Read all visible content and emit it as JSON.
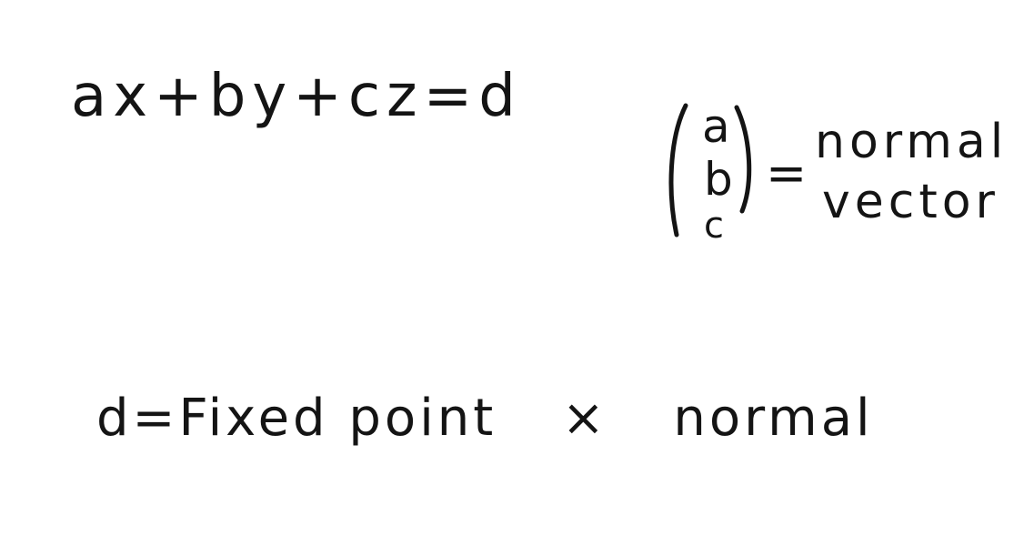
{
  "notes": {
    "equation": "ax+by+cz=d",
    "vector": {
      "components": [
        "a",
        "b",
        "c"
      ],
      "equals": "=",
      "label_line1": "normal",
      "label_line2": "vector"
    },
    "definition": {
      "lhs": "d=Fixed point",
      "operator": "×",
      "rhs": "normal"
    }
  },
  "colors": {
    "ink": "#141414",
    "paper": "#ffffff"
  }
}
